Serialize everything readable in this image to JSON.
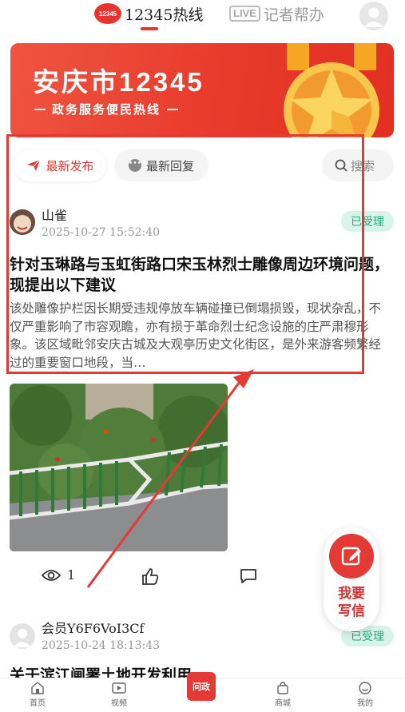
{
  "header": {
    "hotline_logo_text": "12345",
    "hotline_tab": "12345热线",
    "live_badge": "LIVE",
    "reporter_tab": "记者帮办"
  },
  "banner": {
    "title": "安庆市12345",
    "subtitle": "政务服务便民热线"
  },
  "filters": {
    "latest": "最新发布",
    "reply": "最新回复",
    "search": "搜索"
  },
  "posts": [
    {
      "author": "山雀",
      "time": "2025-10-27 15:52:40",
      "status": "已受理",
      "title": "针对玉琳路与玉虹街路口宋玉林烈士雕像周边环境问题，现提出以下建议",
      "body": "该处雕像护栏因长期受违规停放车辆碰撞已倒塌损毁，现状杂乱，不仅严重影响了市容观瞻，亦有损于革命烈士纪念设施的庄严肃穆形象。该区域毗邻安庆古城及大观亭历史文化街区，是外来游客频繁经过的重要窗口地段，当…",
      "views": "1"
    },
    {
      "author": "会员Y6F6VoI3Cf",
      "time": "2025-10-24 18:13:43",
      "status": "已受理",
      "title": "关于滨江闸署土地开发利用"
    }
  ],
  "fab": {
    "line1": "我要",
    "line2": "写信"
  },
  "nav": {
    "home": "首页",
    "video": "视频",
    "center": "问政",
    "mall": "商城",
    "mine": "我的"
  },
  "colors": {
    "accent": "#e53935",
    "status_text": "#1fae7c",
    "status_bg": "#d7f3ea"
  }
}
